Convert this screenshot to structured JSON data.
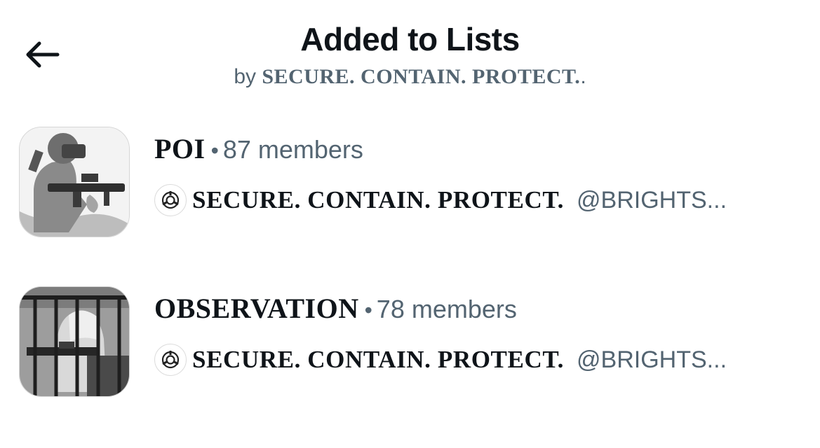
{
  "header": {
    "title": "Added to Lists",
    "by_prefix": "by",
    "owner": "SECURE. CONTAIN. PROTECT."
  },
  "lists": [
    {
      "name": "POI",
      "separator": "•",
      "members": "87 members",
      "owner_name": "SECURE. CONTAIN. PROTECT.",
      "owner_handle": "@BRIGHTS..."
    },
    {
      "name": "OBSERVATION",
      "separator": "•",
      "members": "78 members",
      "owner_name": "SECURE. CONTAIN. PROTECT.",
      "owner_handle": "@BRIGHTS..."
    }
  ],
  "icons": {
    "back": "arrow-left-icon",
    "owner_logo": "scp-logo-icon"
  }
}
